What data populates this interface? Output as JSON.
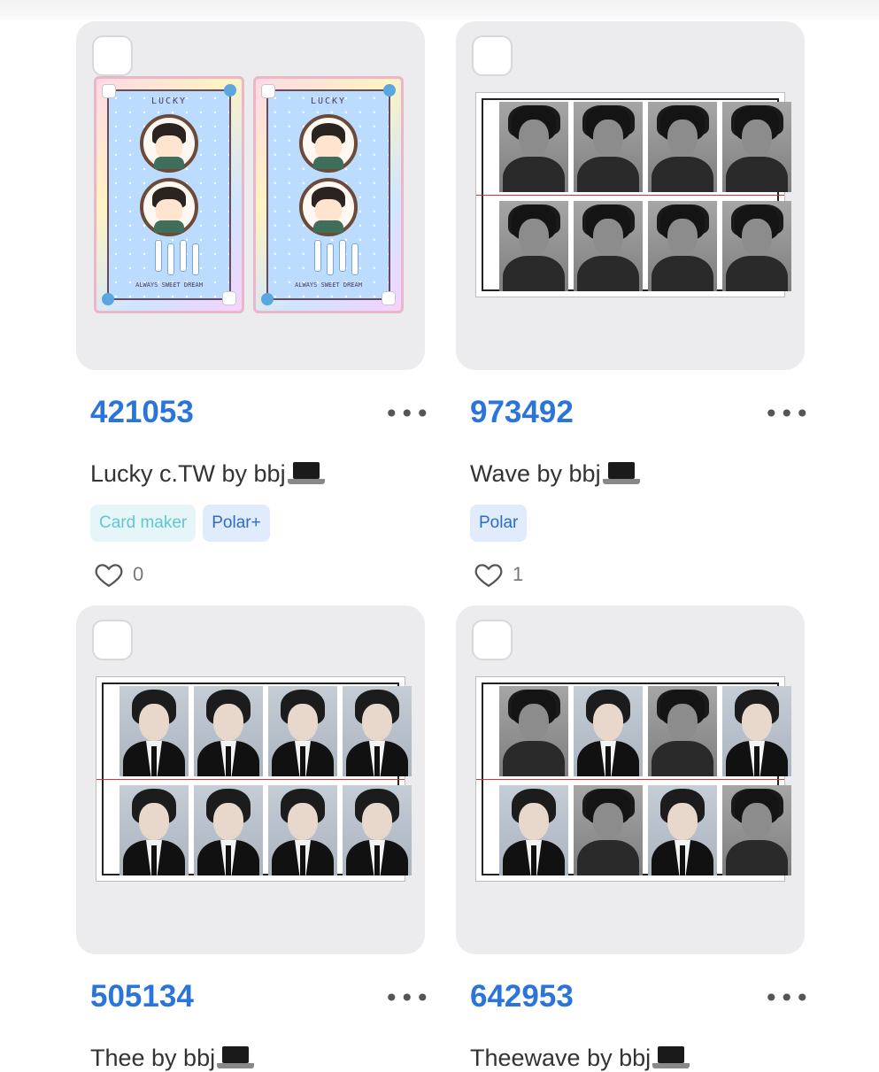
{
  "items": [
    {
      "id": "421053",
      "title": "Lucky c.TW by bbj",
      "title_icon": "laptop-icon",
      "tags": [
        "Card maker",
        "Polar+"
      ],
      "likes": "0",
      "more": "•••",
      "art": {
        "type": "card",
        "card_text": "LUCKY",
        "card_footer": "ALWAYS SWEET DREAM"
      }
    },
    {
      "id": "973492",
      "title": "Wave by bbj",
      "title_icon": "laptop-icon",
      "tags": [
        "Polar"
      ],
      "likes": "1",
      "more": "•••",
      "art": {
        "type": "photo-sheet",
        "pattern": [
          "grey",
          "grey",
          "grey",
          "grey",
          "grey",
          "grey",
          "grey",
          "grey"
        ]
      }
    },
    {
      "id": "505134",
      "title": "Thee by bbj",
      "title_icon": "laptop-icon",
      "tags": [],
      "likes": "",
      "more": "•••",
      "art": {
        "type": "photo-sheet",
        "pattern": [
          "blue",
          "blue",
          "blue",
          "blue",
          "blue",
          "blue",
          "blue",
          "blue"
        ]
      }
    },
    {
      "id": "642953",
      "title": "Theewave by bbj",
      "title_icon": "laptop-icon",
      "tags": [],
      "likes": "",
      "more": "•••",
      "art": {
        "type": "photo-sheet",
        "pattern": [
          "grey",
          "blue",
          "grey",
          "blue",
          "blue",
          "grey",
          "blue",
          "grey"
        ]
      }
    }
  ],
  "colors": {
    "id_text": "#2b74d9",
    "tag_polar_bg": "#e0ebfb",
    "tag_maker_bg": "#e6f6f8"
  }
}
